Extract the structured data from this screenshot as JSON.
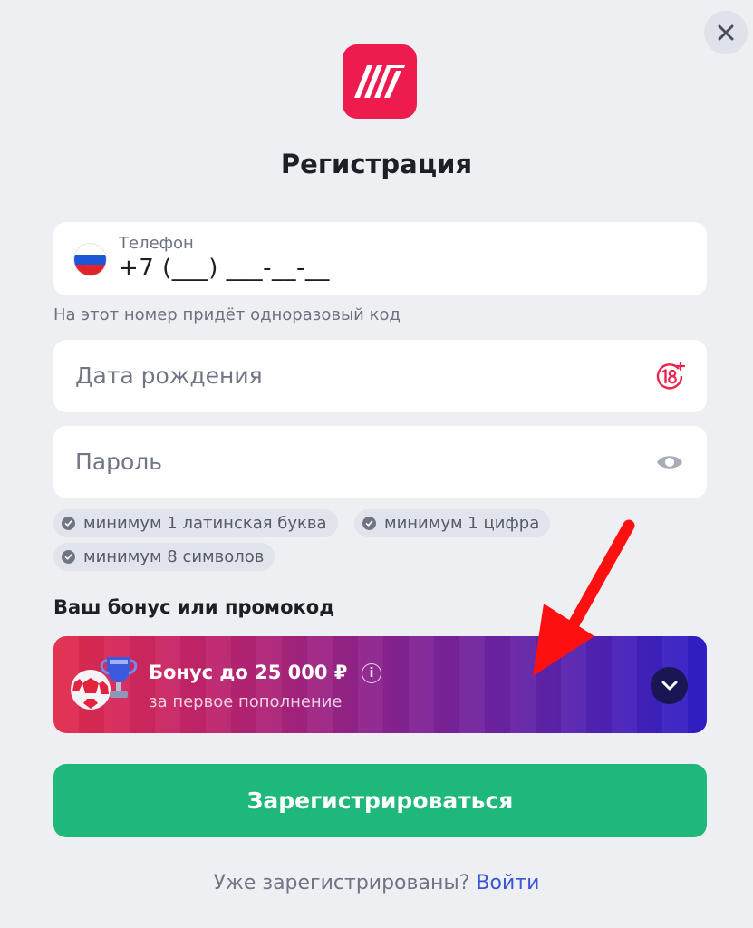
{
  "header": {
    "title": "Регистрация",
    "logo_icon": "brand-logo-icon",
    "close_icon": "close-icon"
  },
  "phone": {
    "label": "Телефон",
    "value": "+7 (___) ___-__-__",
    "hint": "На этот номер придёт одноразовый код",
    "country_flag": "russia-flag-icon"
  },
  "birthdate": {
    "placeholder": "Дата рождения",
    "icon": "age-18-plus-icon"
  },
  "password": {
    "placeholder": "Пароль",
    "icon": "eye-icon",
    "requirements": [
      "минимум 1 латинская буква",
      "минимум 1 цифра",
      "минимум 8 символов"
    ]
  },
  "bonus": {
    "section_label": "Ваш бонус или промокод",
    "title": "Бонус до 25 000 ₽",
    "subtitle": "за первое пополнение",
    "info_glyph": "i",
    "toggle_icon": "chevron-down-icon"
  },
  "actions": {
    "register_label": "Зарегистрироваться",
    "login_prompt": "Уже зарегистрированы?",
    "login_link": "Войти"
  },
  "colors": {
    "background": "#edeff3",
    "brand": "#ee1b4f",
    "register_button": "#1db87a",
    "link": "#3a56d4",
    "annotation_arrow": "#ff1010"
  }
}
